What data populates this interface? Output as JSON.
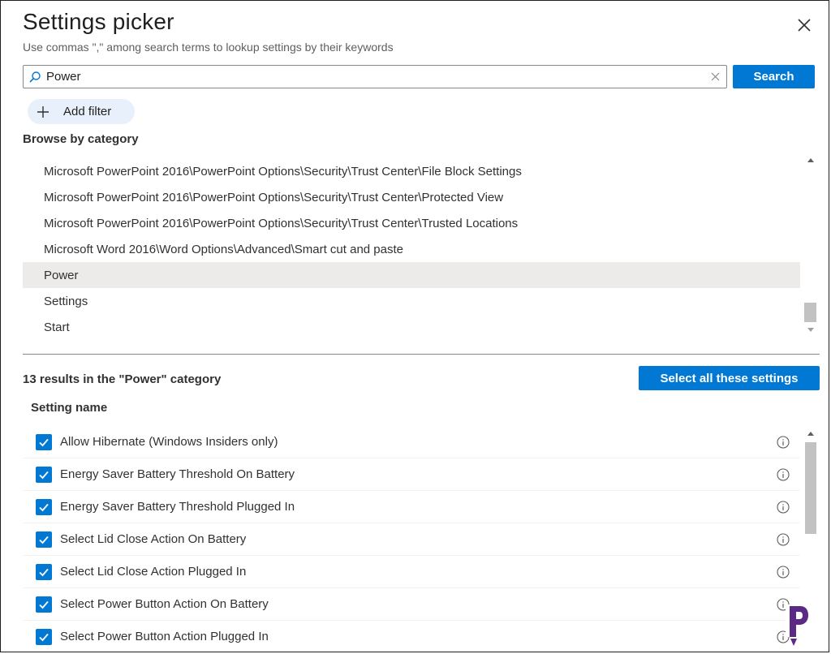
{
  "dialog": {
    "title": "Settings picker",
    "subtitle": "Use commas \",\" among search terms to lookup settings by their keywords"
  },
  "search": {
    "value": "Power",
    "button_label": "Search"
  },
  "filter": {
    "add_label": "Add filter"
  },
  "browse": {
    "title": "Browse by category",
    "items": [
      {
        "label": "Microsoft PowerPoint 2016\\PowerPoint Options\\Security\\Trust Center\\File Block Settings",
        "selected": false
      },
      {
        "label": "Microsoft PowerPoint 2016\\PowerPoint Options\\Security\\Trust Center\\Protected View",
        "selected": false
      },
      {
        "label": "Microsoft PowerPoint 2016\\PowerPoint Options\\Security\\Trust Center\\Trusted Locations",
        "selected": false
      },
      {
        "label": "Microsoft Word 2016\\Word Options\\Advanced\\Smart cut and paste",
        "selected": false
      },
      {
        "label": "Power",
        "selected": true
      },
      {
        "label": "Settings",
        "selected": false
      },
      {
        "label": "Start",
        "selected": false
      }
    ]
  },
  "results": {
    "summary": "13 results in the \"Power\" category",
    "select_all_label": "Select all these settings",
    "column_header": "Setting name",
    "settings": [
      {
        "label": "Allow Hibernate (Windows Insiders only)",
        "checked": true
      },
      {
        "label": "Energy Saver Battery Threshold On Battery",
        "checked": true
      },
      {
        "label": "Energy Saver Battery Threshold Plugged In",
        "checked": true
      },
      {
        "label": "Select Lid Close Action On Battery",
        "checked": true
      },
      {
        "label": "Select Lid Close Action Plugged In",
        "checked": true
      },
      {
        "label": "Select Power Button Action On Battery",
        "checked": true
      },
      {
        "label": "Select Power Button Action Plugged In",
        "checked": true
      }
    ]
  },
  "colors": {
    "accent": "#0078d4",
    "selected_row": "#edebe9",
    "filter_pill": "#e8f1fb",
    "logo_purple": "#5b2a86"
  },
  "icons": {
    "close": "close-icon",
    "search": "search-icon",
    "clear": "clear-icon",
    "add": "plus-icon",
    "info": "info-icon",
    "check": "checkmark-icon"
  }
}
